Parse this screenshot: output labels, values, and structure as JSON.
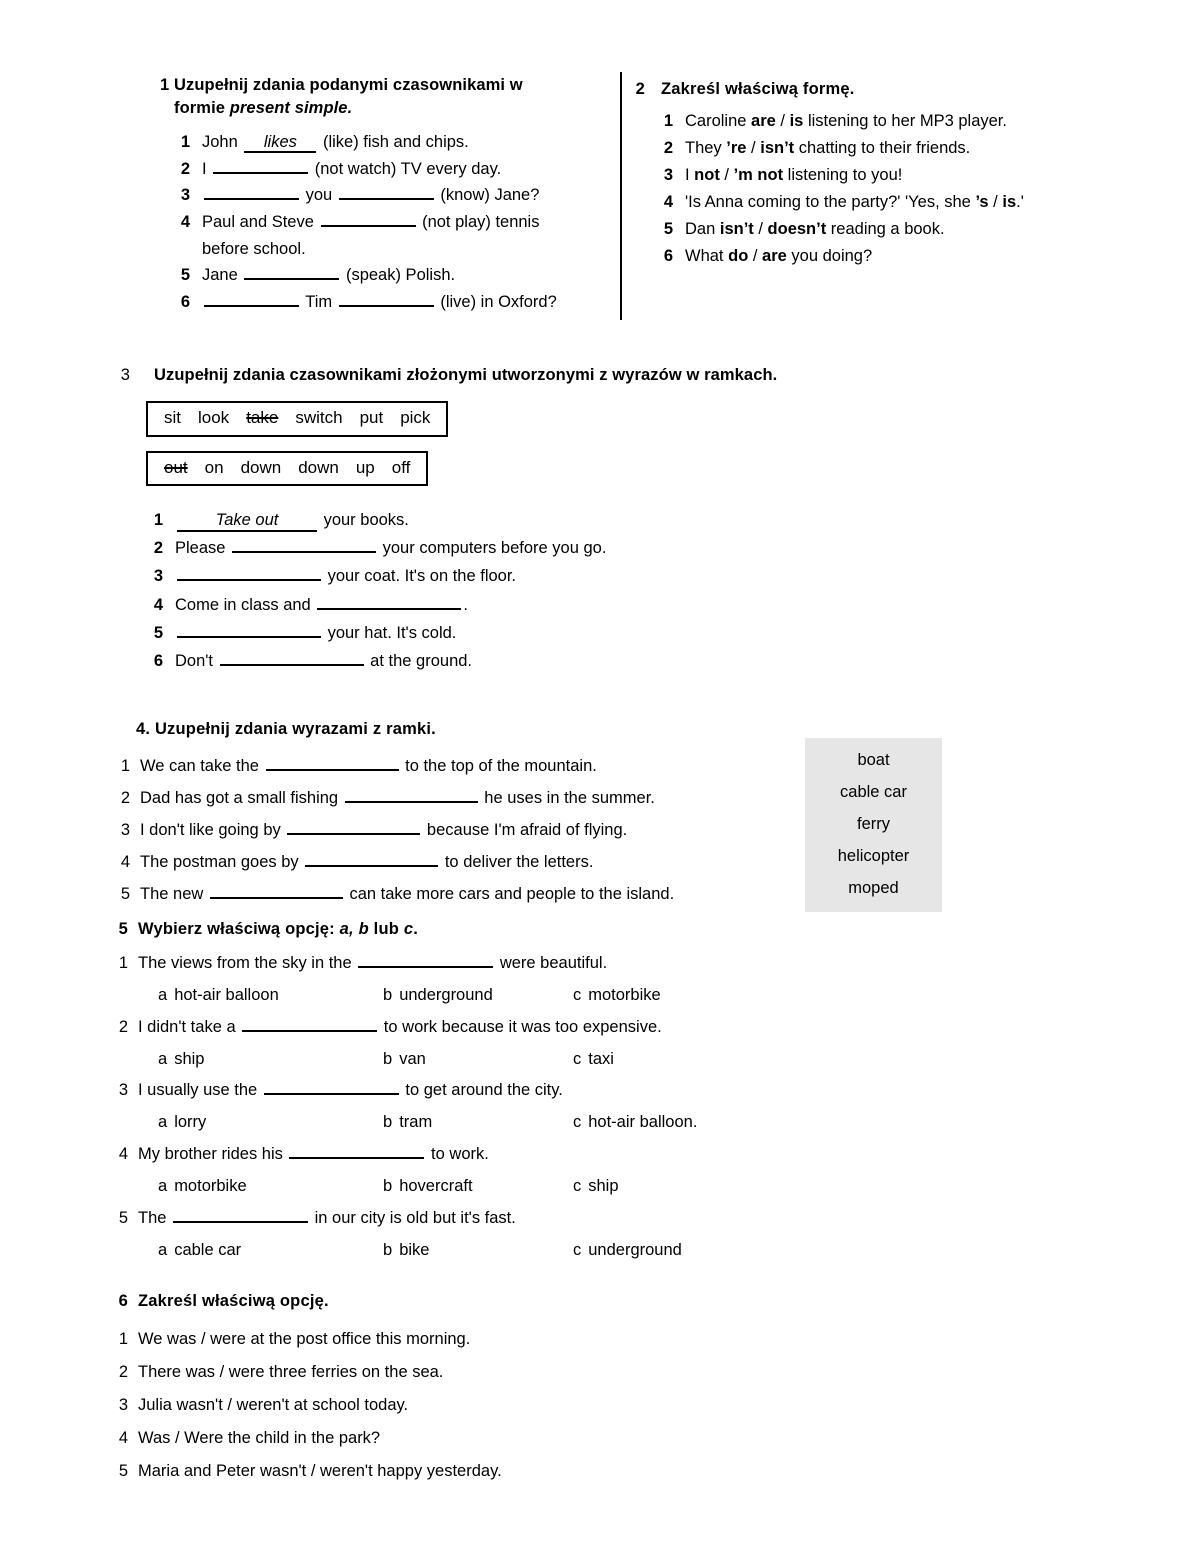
{
  "exercise1": {
    "number": "1",
    "heading_line1": "Uzupełnij zdania podanymi czasownikami w",
    "heading_line2_plain": "formie ",
    "heading_line2_italic": "present simple.",
    "items": [
      {
        "n": "1",
        "pre": "John ",
        "answer": "likes",
        "post": " (like) fish and chips."
      },
      {
        "n": "2",
        "pre": "I ",
        "answer": "",
        "post": " (not watch) TV every day."
      },
      {
        "n": "3",
        "pre": "",
        "answer": "",
        "mid": " you ",
        "answer2": "",
        "post": " (know) Jane?"
      },
      {
        "n": "4",
        "pre": "Paul and Steve ",
        "answer": "",
        "post": " (not play) tennis",
        "cont": "before school."
      },
      {
        "n": "5",
        "pre": "Jane ",
        "answer": "",
        "post": " (speak) Polish."
      },
      {
        "n": "6",
        "pre": "",
        "answer": "",
        "mid": " Tim ",
        "answer2": "",
        "post": " (live) in Oxford?"
      }
    ]
  },
  "exercise2": {
    "number": "2",
    "heading": "Zakreśl właściwą formę.",
    "items": [
      {
        "n": "1",
        "p1": "Caroline ",
        "b1": "are",
        "sep": " / ",
        "b2": "is",
        "p2": "  listening to her MP3 player."
      },
      {
        "n": "2",
        "p1": "They ",
        "b1": "’re",
        "sep": " / ",
        "b2": "isn’t",
        "p2": " chatting to their friends."
      },
      {
        "n": "3",
        "p1": "I ",
        "b1": "not",
        "sep": " / ",
        "b2": "’m not",
        "p2": " listening to you!"
      },
      {
        "n": "4",
        "p1": "'Is Anna coming to the party?' 'Yes, she ",
        "b1": "’s",
        "sep": " / ",
        "b2": "is",
        "p2": ".'"
      },
      {
        "n": "5",
        "p1": "Dan ",
        "b1": "isn’t",
        "sep": " / ",
        "b2": "doesn’t",
        "p2": " reading a book."
      },
      {
        "n": "6",
        "p1": "What ",
        "b1": "do",
        "sep": " / ",
        "b2": "are",
        "p2": " you doing?"
      }
    ]
  },
  "exercise3": {
    "number": "3",
    "heading": "Uzupełnij zdania czasownikami złożonymi utworzonymi z wyrazów w ramkach.",
    "verb_box": [
      {
        "word": "sit",
        "struck": false
      },
      {
        "word": "look",
        "struck": false
      },
      {
        "word": "take",
        "struck": true
      },
      {
        "word": "switch",
        "struck": false
      },
      {
        "word": "put",
        "struck": false
      },
      {
        "word": "pick",
        "struck": false
      }
    ],
    "particle_box": [
      {
        "word": "out",
        "struck": true
      },
      {
        "word": "on",
        "struck": false
      },
      {
        "word": "down",
        "struck": false
      },
      {
        "word": "down",
        "struck": false
      },
      {
        "word": "up",
        "struck": false
      },
      {
        "word": "off",
        "struck": false
      }
    ],
    "items": [
      {
        "n": "1",
        "pre": "",
        "answer": "Take out",
        "post": " your books."
      },
      {
        "n": "2",
        "pre": "Please ",
        "answer": "",
        "post": " your computers before you go."
      },
      {
        "n": "3",
        "pre": "",
        "answer": "",
        "post": " your coat. It's on the floor."
      },
      {
        "n": "4",
        "pre": "Come in class and ",
        "answer": "",
        "post": "."
      },
      {
        "n": "5",
        "pre": "",
        "answer": "",
        "post": " your hat. It's cold."
      },
      {
        "n": "6",
        "pre": "Don't ",
        "answer": "",
        "post": " at the ground."
      }
    ]
  },
  "exercise4": {
    "heading": "4. Uzupełnij zdania wyrazami z ramki.",
    "items": [
      {
        "n": "1",
        "pre": " We can take the ",
        "post": " to the top of the mountain."
      },
      {
        "n": "2",
        "pre": "Dad has got a small fishing ",
        "post": " he uses in the summer."
      },
      {
        "n": "3",
        "pre": "I don't like going by ",
        "post": " because I'm afraid of flying."
      },
      {
        "n": "4",
        "pre": "The postman goes by ",
        "post": " to deliver the letters."
      },
      {
        "n": "5",
        "pre": "The new ",
        "post": " can take more cars and people to the island."
      }
    ],
    "word_bank": [
      "boat",
      "cable car",
      "ferry",
      "helicopter",
      "moped"
    ],
    "word_bank_bg": "#e6e6e6"
  },
  "exercise5": {
    "number": "5",
    "heading_plain1": "Wybierz właściwą opcję: ",
    "heading_italic1": "a, b",
    "heading_plain2": " lub ",
    "heading_italic2": "c",
    "heading_plain3": ".",
    "items": [
      {
        "n": "1",
        "pre": "The views from the sky in the ",
        "post": " were beautiful.",
        "options": [
          {
            "label": "a",
            "text": "hot-air balloon"
          },
          {
            "label": "b",
            "text": "underground"
          },
          {
            "label": "c",
            "text": "motorbike"
          }
        ]
      },
      {
        "n": "2",
        "pre": "I didn't take a ",
        "post": " to work because it was too expensive.",
        "options": [
          {
            "label": "a",
            "text": "ship"
          },
          {
            "label": "b",
            "text": "van"
          },
          {
            "label": "c",
            "text": "taxi"
          }
        ]
      },
      {
        "n": "3",
        "pre": "I usually use the ",
        "post": " to get around the city.",
        "options": [
          {
            "label": "a",
            "text": "lorry"
          },
          {
            "label": "b",
            "text": "tram"
          },
          {
            "label": "c",
            "text": "hot-air balloon."
          }
        ]
      },
      {
        "n": "4",
        "pre": "My brother rides his ",
        "post": " to work.",
        "options": [
          {
            "label": "a",
            "text": "motorbike"
          },
          {
            "label": "b",
            "text": "hovercraft"
          },
          {
            "label": "c",
            "text": "ship"
          }
        ]
      },
      {
        "n": "5",
        "pre": "The ",
        "post": " in our city is old but it's fast.",
        "options": [
          {
            "label": "a",
            "text": "cable car"
          },
          {
            "label": "b",
            "text": "bike"
          },
          {
            "label": "c",
            "text": "underground"
          }
        ]
      }
    ]
  },
  "exercise6": {
    "number": "6",
    "heading": "Zakreśl właściwą opcję.",
    "items": [
      {
        "n": "1",
        "text": "We was / were at the post office this morning."
      },
      {
        "n": "2",
        "text": "There was / were three ferries on the sea."
      },
      {
        "n": "3",
        "text": "Julia wasn't / weren't at school today."
      },
      {
        "n": "4",
        "text": "Was / Were the child in the park?"
      },
      {
        "n": "5",
        "text": "Maria and Peter wasn't / weren't happy yesterday."
      }
    ]
  }
}
